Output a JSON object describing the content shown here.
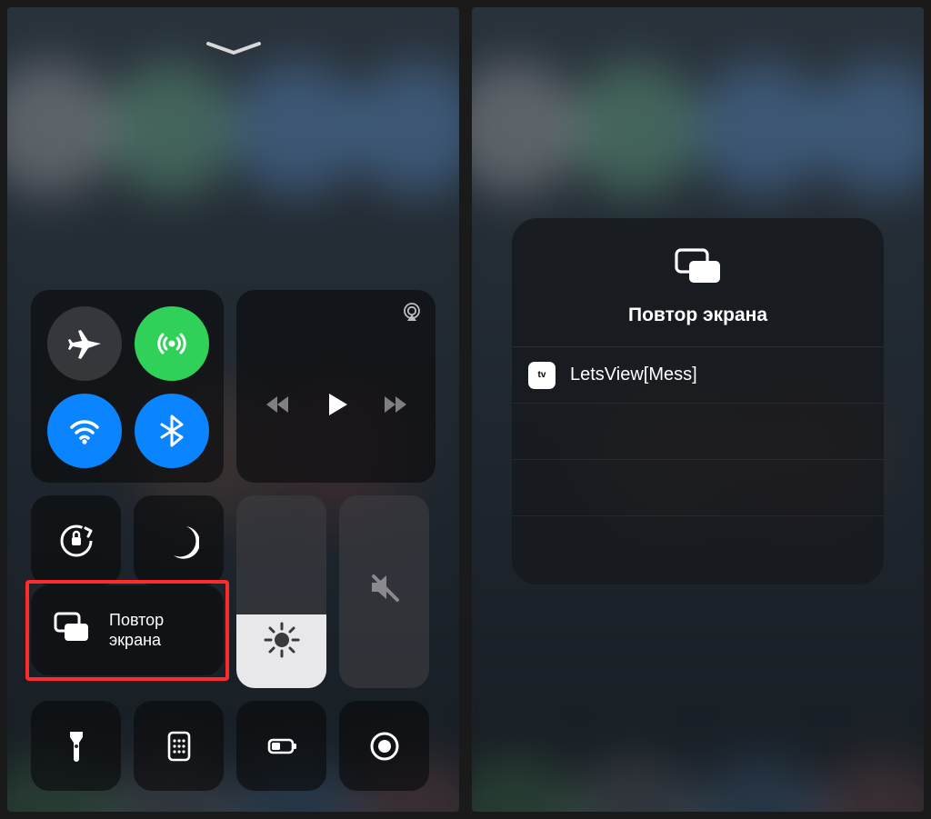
{
  "left": {
    "mirror_line1": "Повтор",
    "mirror_line2": "экрана"
  },
  "right": {
    "title": "Повтор экрана",
    "device_name": "LetsView[Mess]",
    "device_badge": "tv"
  }
}
